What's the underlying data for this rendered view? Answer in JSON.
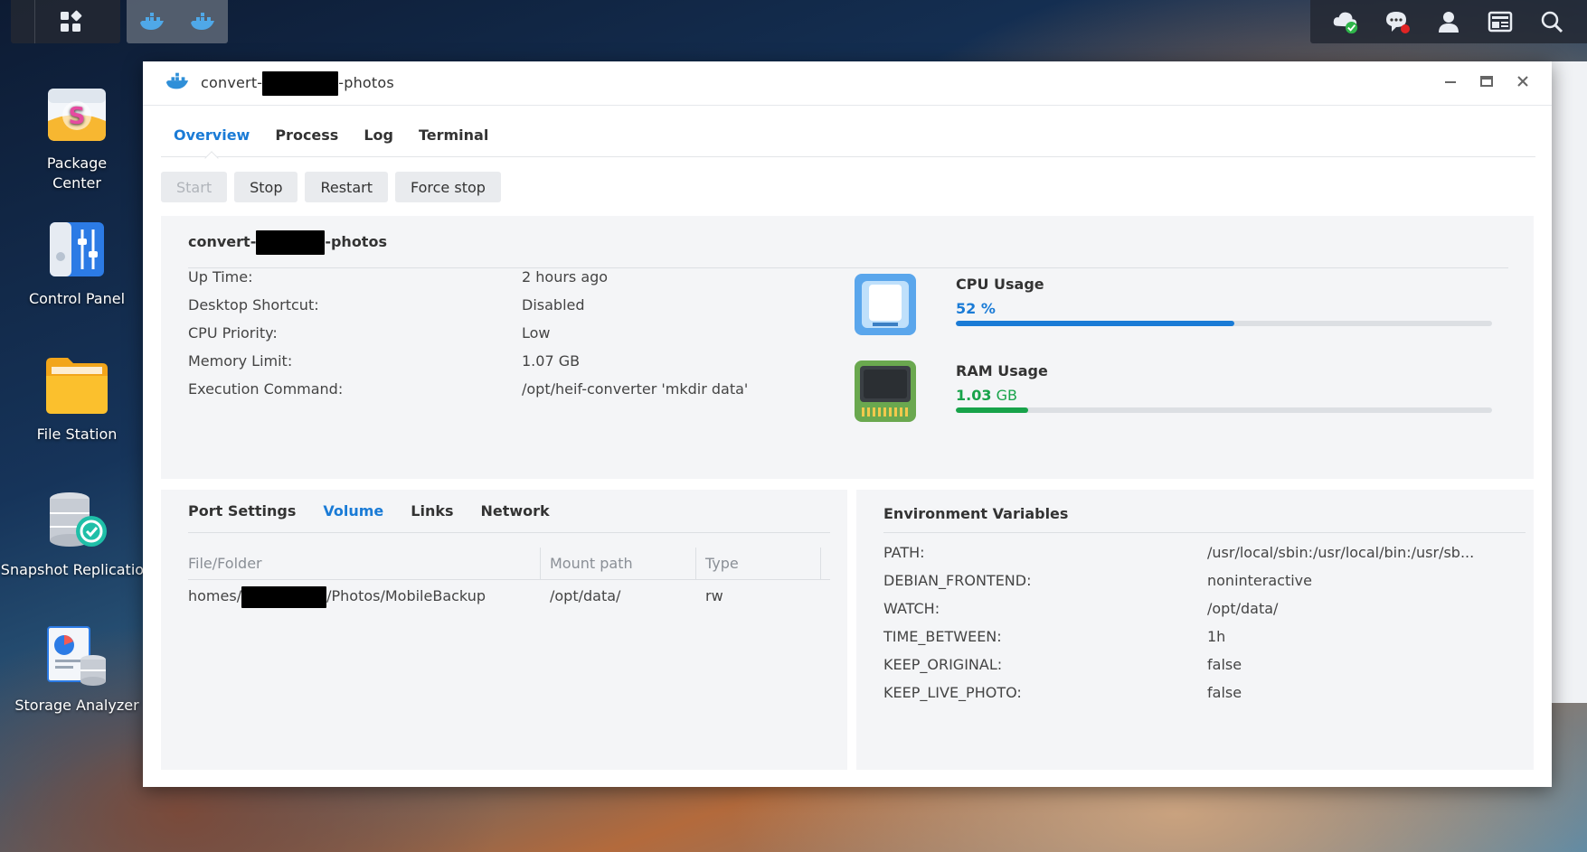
{
  "desktop": {
    "icons": [
      {
        "label": "Package Center",
        "icon": "package-center-icon"
      },
      {
        "label": "Control Panel",
        "icon": "control-panel-icon"
      },
      {
        "label": "File Station",
        "icon": "folder-icon"
      },
      {
        "label": "Snapshot Replication",
        "icon": "snapshot-icon"
      },
      {
        "label": "Storage Analyzer",
        "icon": "storage-analyzer-icon"
      }
    ]
  },
  "window": {
    "title_prefix": "convert-",
    "title_suffix": "-photos",
    "tabs": [
      "Overview",
      "Process",
      "Log",
      "Terminal"
    ],
    "active_tab": "Overview",
    "buttons": {
      "start": "Start",
      "stop": "Stop",
      "restart": "Restart",
      "force_stop": "Force stop"
    }
  },
  "overview": {
    "name_prefix": "convert-",
    "name_suffix": "-photos",
    "info": [
      {
        "key": "Up Time:",
        "value": "2 hours ago"
      },
      {
        "key": "Desktop Shortcut:",
        "value": "Disabled"
      },
      {
        "key": "CPU Priority:",
        "value": "Low"
      },
      {
        "key": "Memory Limit:",
        "value": "1.07 GB"
      },
      {
        "key": "Execution Command:",
        "value": "/opt/heif-converter 'mkdir data'"
      }
    ],
    "cpu": {
      "label": "CPU Usage",
      "value": "52",
      "unit": " %",
      "percent": 52,
      "color": "#1a7bd6"
    },
    "ram": {
      "label": "RAM Usage",
      "value": "1.03",
      "unit": " GB",
      "percent": 13.5,
      "color": "#18a34a"
    }
  },
  "volume_panel": {
    "tabs": [
      "Port Settings",
      "Volume",
      "Links",
      "Network"
    ],
    "active_tab": "Volume",
    "columns": [
      "File/Folder",
      "Mount path",
      "Type"
    ],
    "rows": [
      {
        "path_prefix": "homes/",
        "path_suffix": "/Photos/MobileBackup",
        "mount": "/opt/data/",
        "type": "rw"
      }
    ]
  },
  "env_panel": {
    "title": "Environment Variables",
    "vars": [
      {
        "key": "PATH:",
        "value": "/usr/local/sbin:/usr/local/bin:/usr/sb..."
      },
      {
        "key": "DEBIAN_FRONTEND:",
        "value": "noninteractive"
      },
      {
        "key": "WATCH:",
        "value": "/opt/data/"
      },
      {
        "key": "TIME_BETWEEN:",
        "value": "1h"
      },
      {
        "key": "KEEP_ORIGINAL:",
        "value": "false"
      },
      {
        "key": "KEEP_LIVE_PHOTO:",
        "value": "false"
      }
    ]
  },
  "colors": {
    "accent": "#1a7bd6",
    "ram": "#18a34a"
  }
}
